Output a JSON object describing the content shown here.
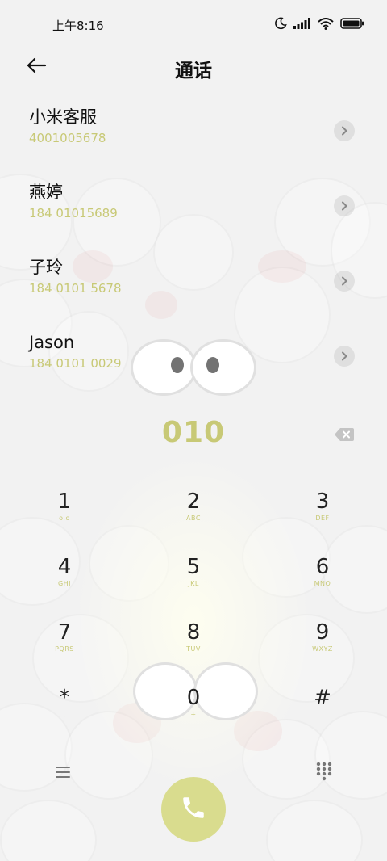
{
  "status_bar": {
    "time": "上午8:16"
  },
  "header": {
    "title": "通话"
  },
  "contacts": [
    {
      "name": "小米客服",
      "number": "4001005678"
    },
    {
      "name": "燕婷",
      "number": "184 01015689"
    },
    {
      "name": "子玲",
      "number": "184 0101 5678"
    },
    {
      "name": "Jason",
      "number": "184 0101 0029"
    }
  ],
  "dialpad": {
    "entered": "010",
    "keys": [
      {
        "digit": "1",
        "letters": "o.o"
      },
      {
        "digit": "2",
        "letters": "ABC"
      },
      {
        "digit": "3",
        "letters": "DEF"
      },
      {
        "digit": "4",
        "letters": "GHI"
      },
      {
        "digit": "5",
        "letters": "JKL"
      },
      {
        "digit": "6",
        "letters": "MNO"
      },
      {
        "digit": "7",
        "letters": "PQRS"
      },
      {
        "digit": "8",
        "letters": "TUV"
      },
      {
        "digit": "9",
        "letters": "WXYZ"
      },
      {
        "digit": "*",
        "letters": ","
      },
      {
        "digit": "0",
        "letters": "+"
      },
      {
        "digit": "#",
        "letters": ""
      }
    ]
  },
  "colors": {
    "accent": "#c8c976",
    "call_button": "#d9dc8e",
    "background": "#f2f2f2"
  },
  "icons": {
    "back": "back-arrow-icon",
    "moon": "moon-icon",
    "signal": "signal-icon",
    "wifi": "wifi-icon",
    "battery": "battery-icon",
    "chevron": "chevron-right-icon",
    "delete": "backspace-icon",
    "menu": "menu-icon",
    "dialpad": "dialpad-icon",
    "call": "phone-icon"
  }
}
